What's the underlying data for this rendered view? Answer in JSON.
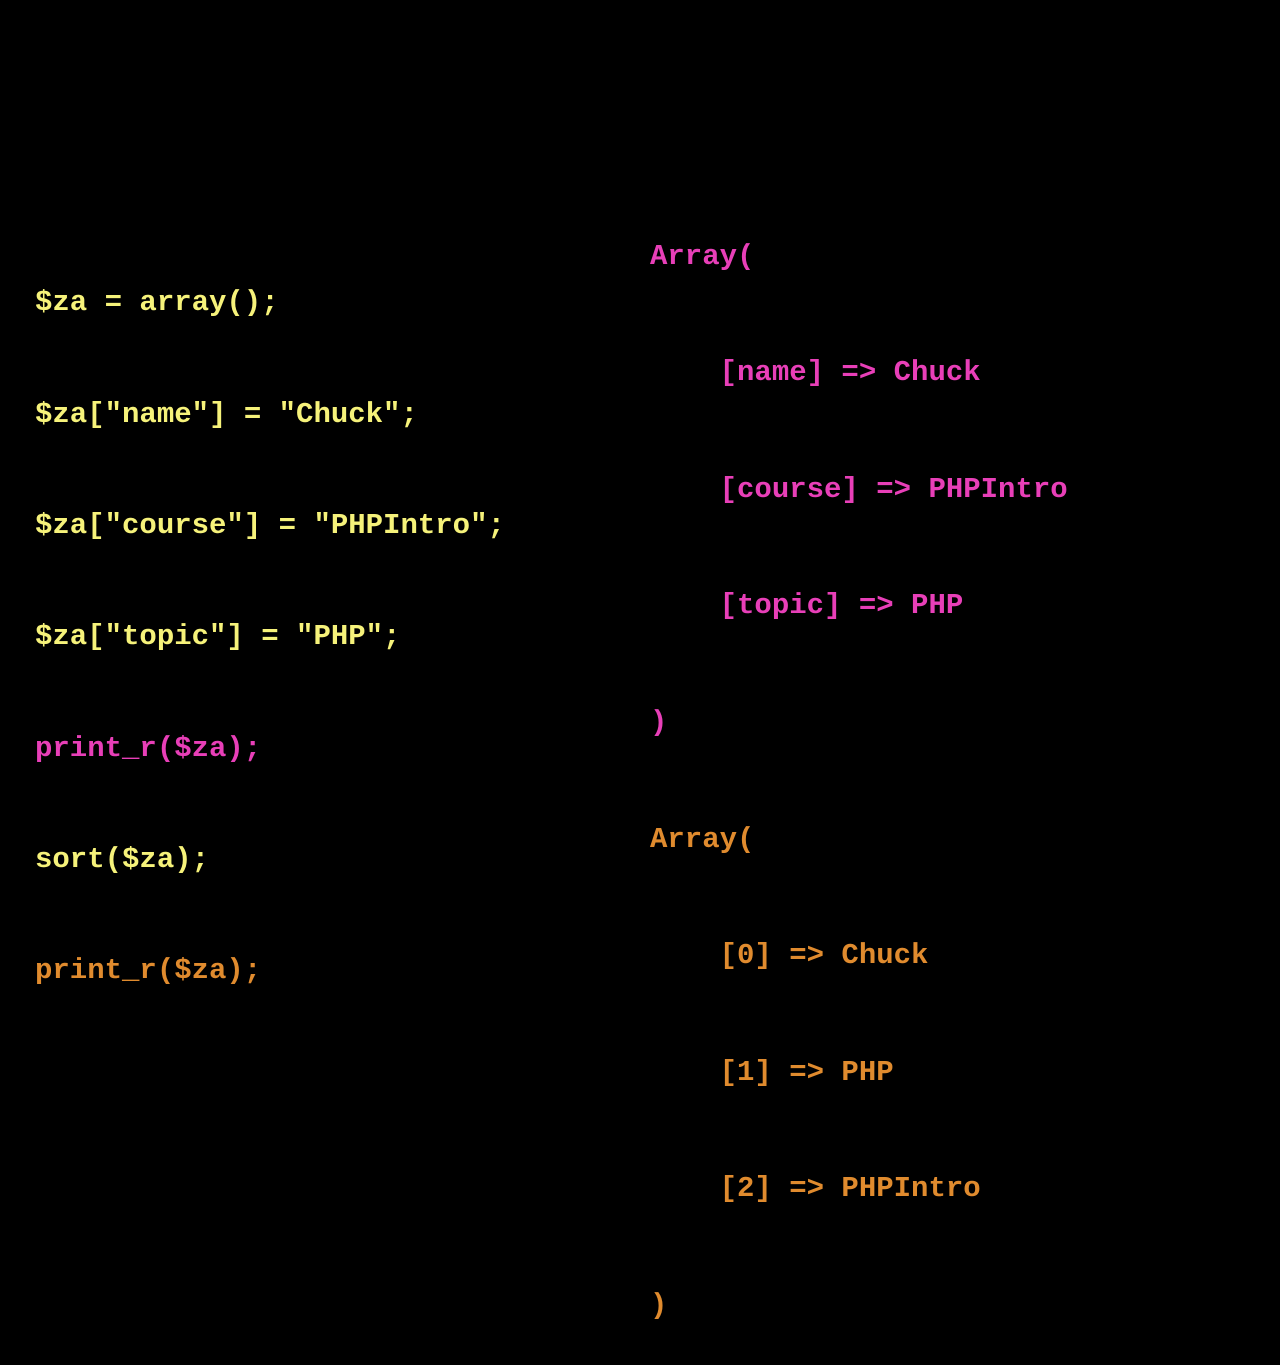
{
  "left": {
    "l1": "$za = array();",
    "l2": "$za[\"name\"] = \"Chuck\";",
    "l3": "$za[\"course\"] = \"PHPIntro\";",
    "l4": "$za[\"topic\"] = \"PHP\";",
    "l5": "print_r($za);",
    "l6": "sort($za);",
    "l7": "print_r($za);"
  },
  "right": {
    "r1": "Array(",
    "r2": "    [name] => Chuck",
    "r3": "    [course] => PHPIntro",
    "r4": "    [topic] => PHP",
    "r5": ")",
    "r6": "Array(",
    "r7": "    [0] => Chuck",
    "r8": "    [1] => PHP",
    "r9": "    [2] => PHPIntro",
    "r10": ")"
  }
}
